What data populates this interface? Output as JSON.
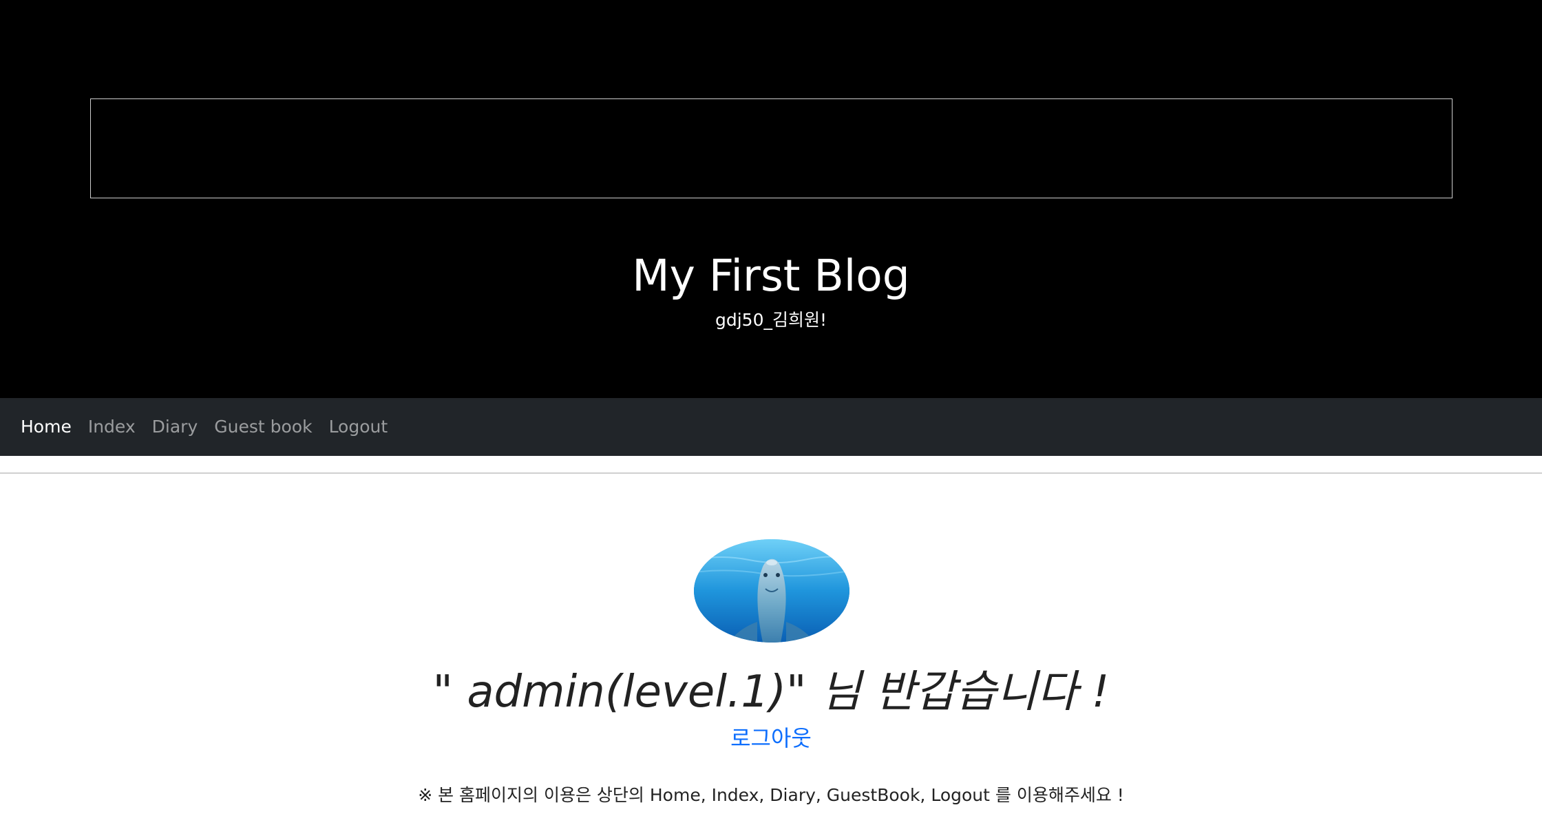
{
  "header": {
    "title": "My First Blog",
    "subtitle": "gdj50_김희원!"
  },
  "nav": {
    "items": [
      {
        "label": "Home",
        "active": true
      },
      {
        "label": "Index",
        "active": false
      },
      {
        "label": "Diary",
        "active": false
      },
      {
        "label": "Guest book",
        "active": false
      },
      {
        "label": "Logout",
        "active": false
      }
    ]
  },
  "main": {
    "avatar_icon": "dolphin-image",
    "welcome": "\" admin(level.1)\" 님 반갑습니다 !",
    "logout_link": "로그아웃",
    "notice": "※ 본 홈페이지의 이용은 상단의 Home, Index, Diary, GuestBook, Logout 를 이용해주세요 !"
  },
  "colors": {
    "header_bg": "#000000",
    "navbar_bg": "#212529",
    "link": "#0d6efd"
  }
}
